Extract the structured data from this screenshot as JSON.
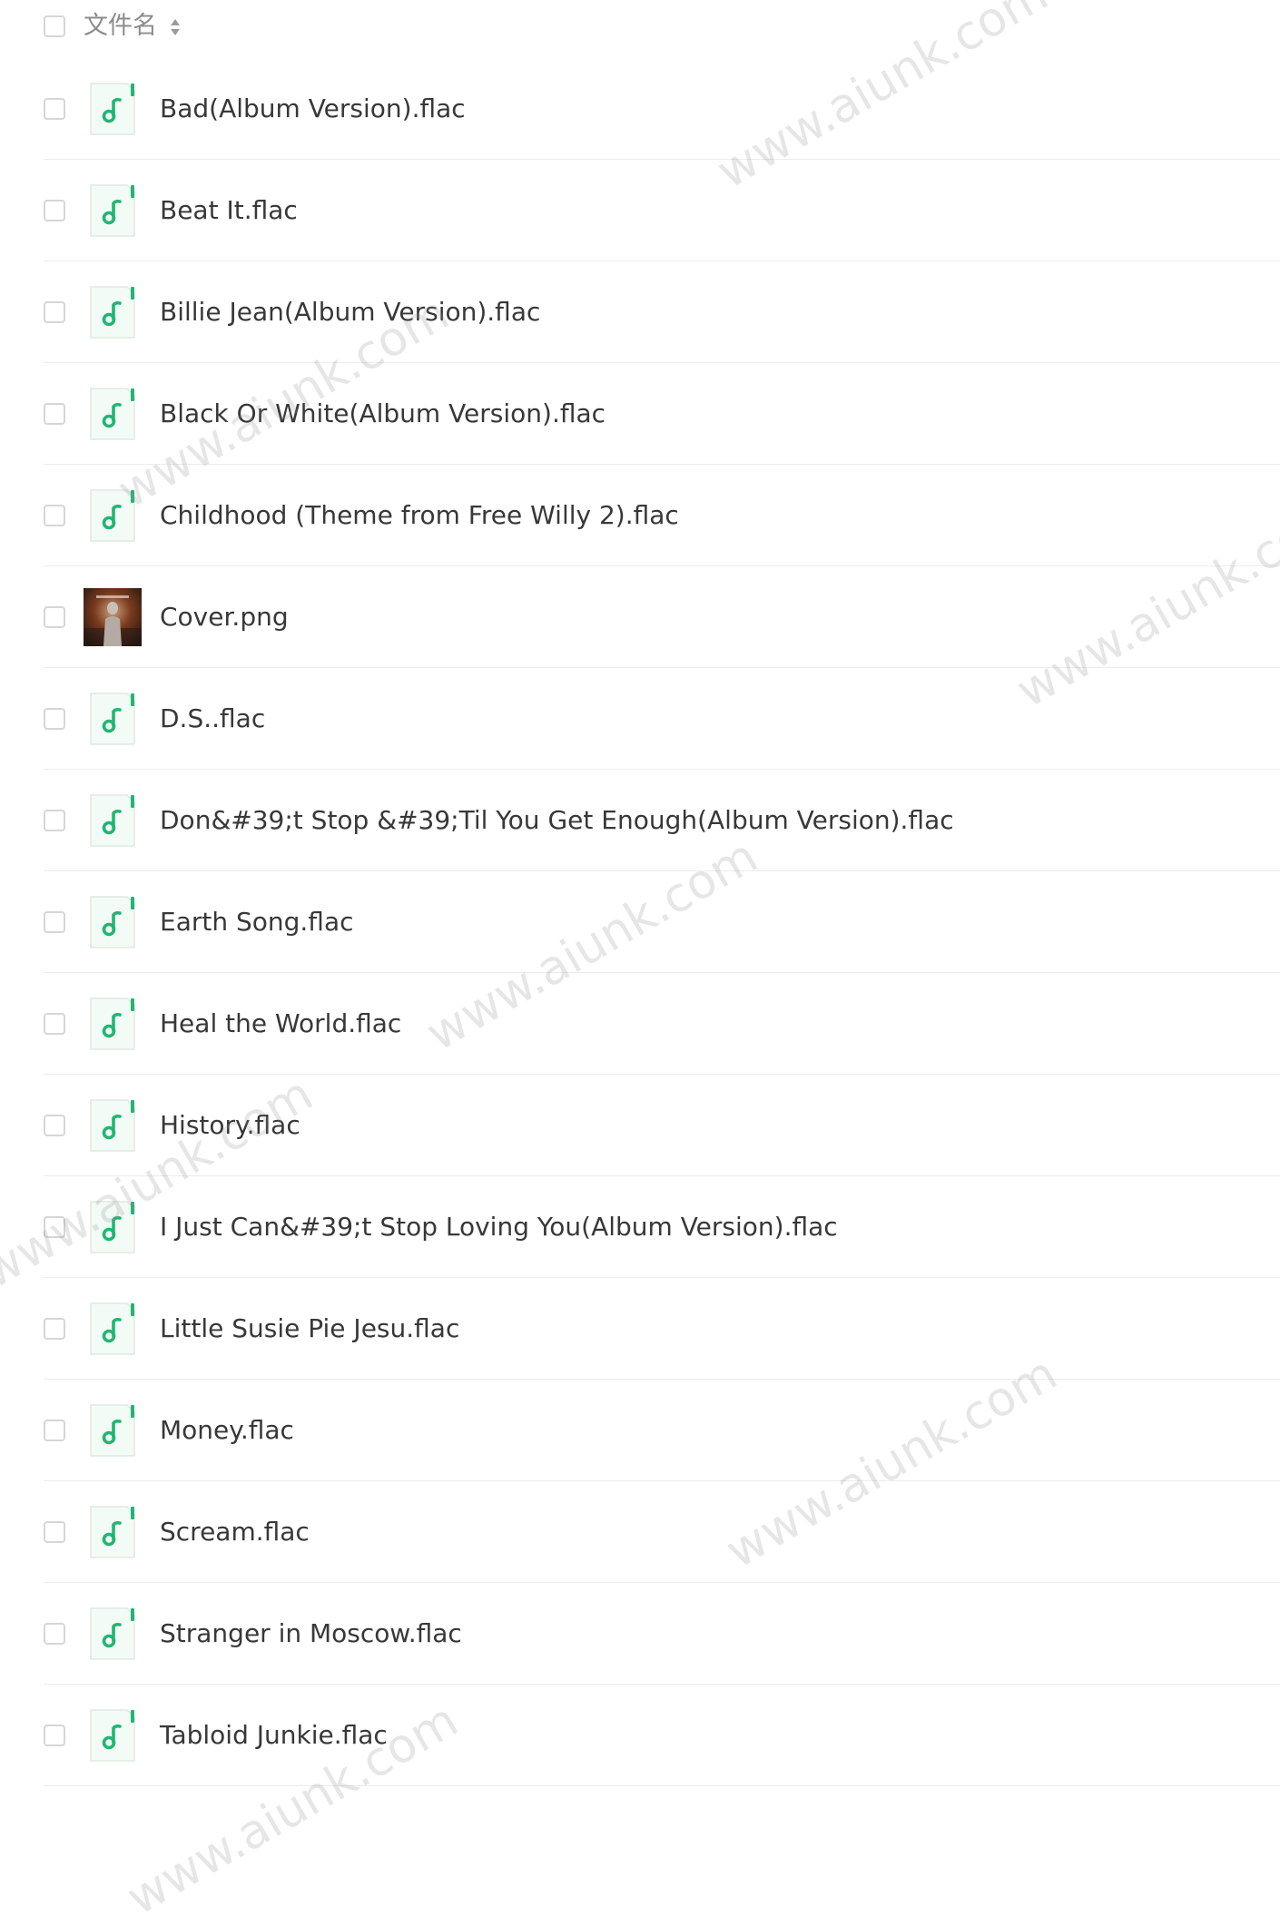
{
  "header": {
    "label": "文件名"
  },
  "files": [
    {
      "name": "Bad(Album Version).flac",
      "type": "audio"
    },
    {
      "name": "Beat It.flac",
      "type": "audio"
    },
    {
      "name": "Billie Jean(Album Version).flac",
      "type": "audio"
    },
    {
      "name": "Black Or White(Album Version).flac",
      "type": "audio"
    },
    {
      "name": "Childhood (Theme from Free Willy 2).flac",
      "type": "audio"
    },
    {
      "name": "Cover.png",
      "type": "image"
    },
    {
      "name": "D.S..flac",
      "type": "audio"
    },
    {
      "name": "Don&#39;t Stop &#39;Til You Get Enough(Album Version).flac",
      "type": "audio"
    },
    {
      "name": "Earth Song.flac",
      "type": "audio"
    },
    {
      "name": "Heal the World.flac",
      "type": "audio"
    },
    {
      "name": "History.flac",
      "type": "audio"
    },
    {
      "name": "I Just Can&#39;t Stop Loving You(Album Version).flac",
      "type": "audio"
    },
    {
      "name": "Little Susie Pie Jesu.flac",
      "type": "audio"
    },
    {
      "name": "Money.flac",
      "type": "audio"
    },
    {
      "name": "Scream.flac",
      "type": "audio"
    },
    {
      "name": "Stranger in Moscow.flac",
      "type": "audio"
    },
    {
      "name": "Tabloid Junkie.flac",
      "type": "audio"
    }
  ],
  "watermark": {
    "text": "www.aiunk.com"
  },
  "colors": {
    "accent": "#22b573",
    "icon_bg": "#f2fbf6",
    "divider": "#ececec"
  }
}
